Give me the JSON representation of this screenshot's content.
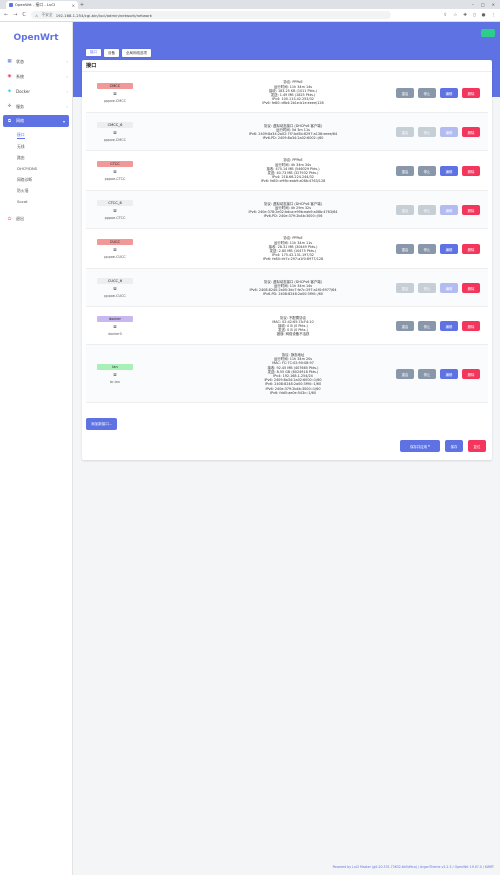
{
  "browser": {
    "tab_title": "OpenWrt - 接口 - LuCI",
    "tab_close": "×",
    "new_tab": "+",
    "security_label": "不安全",
    "url": "192.168.1.254/cgi-bin/luci/admin/network/network",
    "nav_back": "←",
    "nav_forward": "→",
    "nav_reload": "C"
  },
  "sidebar": {
    "logo": "OpenWrt",
    "items": [
      {
        "label": "状态",
        "icon": "dashboard-icon"
      },
      {
        "label": "系统",
        "icon": "system-icon"
      },
      {
        "label": "Docker",
        "icon": "docker-icon"
      },
      {
        "label": "服务",
        "icon": "services-icon"
      },
      {
        "label": "网络",
        "icon": "network-icon"
      },
      {
        "label": "退出",
        "icon": "logout-icon"
      }
    ],
    "submenu": [
      "接口",
      "无线",
      "路由",
      "DHCP/DNS",
      "网络诊断",
      "防火墙",
      "Socat"
    ]
  },
  "header": {
    "button": ""
  },
  "tabs": [
    "接口",
    "设备",
    "全局网络选项"
  ],
  "card": {
    "title": "接口"
  },
  "colors": {
    "accent": "#5e72e4",
    "red": "#f5365c",
    "gray": "#8898aa",
    "badge_red": "#f19999",
    "badge_purple": "#c8b8f0",
    "badge_green": "#a8f0b8",
    "badge_gray": "#eeeeee"
  },
  "interfaces": [
    {
      "name": "CMCC",
      "device": "pppoe-CMCC",
      "badge_color": "#f19999",
      "disabled": false,
      "lines": [
        "协议: PPPoE",
        "运行时间: 11h 34m 14s",
        "接收: 183.25 KB (1011 Pkts.)",
        "发送: 1.49 MB (1825 Pkts.)",
        "IPv4: 100.113.42.253/32",
        "IPv6: fe80::dfb4:2b1e:b1e:eeee/128"
      ]
    },
    {
      "name": "CMCC_6",
      "device": "pppoe-CMCC",
      "badge_color": "#eeeeee",
      "disabled": true,
      "lines": [
        "协议: 虚拟动态接口 (DHCPv6 客户端)",
        "运行时间: 5d 3m 11s",
        "IPv6: 2409:8a34:2a02:7f7:bd5b:6297:a136:eeee/64",
        "IPv6-PD: 2409:8a34:2a02:6002::/60"
      ]
    },
    {
      "name": "CTCC",
      "device": "pppoe-CTCC",
      "badge_color": "#f19999",
      "disabled": false,
      "lines": [
        "协议: PPPoE",
        "运行时间: 4h 34m 34s",
        "接收: 470.14 MB (546029 Pkts.)",
        "发送: 40.73 MB (327932 Pkts.)",
        "IPv4: 218.66.224.244/32",
        "IPv6: fe80::e99b:eab9:a08b:4763/128"
      ]
    },
    {
      "name": "CTCC_6",
      "device": "pppoe-CTCC",
      "badge_color": "#eeeeee",
      "disabled": true,
      "lines": [
        "协议: 虚拟动态接口 (DHCPv6 客户端)",
        "运行时间: 4h 29m 32s",
        "IPv6: 240e:378:2e02:bdca:e99b:eab9:a08b:4763/64",
        "IPv6-PD: 240e:379:2b4b:3000::/56"
      ]
    },
    {
      "name": "CUCC",
      "device": "pppoe-CUCC",
      "badge_color": "#f19999",
      "disabled": false,
      "lines": [
        "协议: PPPoE",
        "运行时间: 11h 34m 11s",
        "接收: 28.31 MB (30449 Pkts.)",
        "发送: 2.80 MB (10475 Pkts.)",
        "IPv4: 175.42.131.197/32",
        "IPv6: fe80::fe7c:297:a1f0:6977/128"
      ]
    },
    {
      "name": "CUCC_6",
      "device": "pppoe-CUCC",
      "badge_color": "#eeeeee",
      "disabled": true,
      "lines": [
        "协议: 虚拟动态接口 (DHCPv6 客户端)",
        "运行时间: 11h 34m 14s",
        "IPv6: 2408:8240:2a00:3dc7:fe7c:297:a1f0:6977/64",
        "IPv6-PD: 2408:8248:2a00:3f90::/60"
      ]
    },
    {
      "name": "docker",
      "device": "docker0",
      "badge_color": "#c8b8f0",
      "disabled": false,
      "lines": [
        "协议: 不配置协议",
        "MAC: 02:42:65:7A:F4:10",
        "接收: 0 B (0 Pkts.)",
        "发送: 0 B (0 Pkts.)",
        "错误: 网络设备不活跃"
      ]
    },
    {
      "name": "lan",
      "device": "br-lan",
      "badge_color": "#a8f0b8",
      "disabled": false,
      "lines": [
        "协议: 静态地址",
        "运行时间: 11h 34m 20s",
        "MAC: FC:7C:02:90:08:97",
        "接收: 92.45 MB (407665 Pkts.)",
        "发送: 8.55 GB (6024918 Pkts.)",
        "IPv4: 192.168.1.254/24",
        "IPv6: 2409:8a34:2a02:6000::1/60",
        "IPv6: 2408:8248:2a00:3f90::1/60",
        "IPv6: 240e:379:2b4b:3000::1/60",
        "IPv6: fdd5:ae0e:543c::1/60"
      ]
    }
  ],
  "actions": {
    "restart": "重启",
    "stop": "停止",
    "edit": "编辑",
    "delete": "删除"
  },
  "add_button": "添加新接口...",
  "footer": {
    "apply": "保存并应用",
    "apply_caret": "▾",
    "save": "保存",
    "reset": "复位"
  },
  "copyright": "Powered by LuCI Master (git-20.331.73632-6e5d9ca) / ArgonTheme v2.2.5 / OpenWrt 19.07.0 / KWRT"
}
